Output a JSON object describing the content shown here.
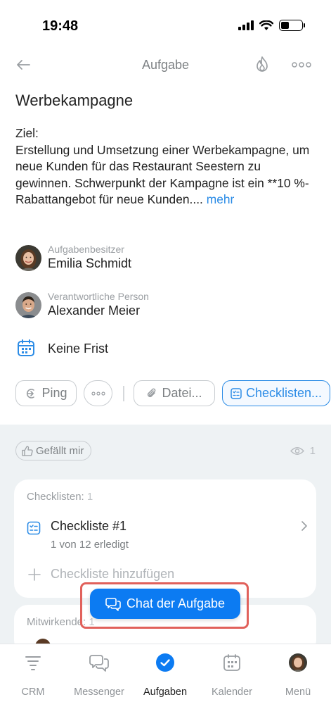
{
  "status_bar": {
    "time": "19:48"
  },
  "header": {
    "title": "Aufgabe",
    "icons": {
      "back": "arrow-left-icon",
      "flame": "flame-icon",
      "more": "more-horizontal-icon"
    }
  },
  "task": {
    "title": "Werbekampagne",
    "description": "Ziel:\nErstellung und Umsetzung einer Werbekampagne, um neue Kunden für das Restaurant Seestern zu gewinnen. Schwerpunkt der Kampagne ist ein **10 %-Rabattangebot für neue Kunden....",
    "more_link": "mehr"
  },
  "people": [
    {
      "role": "Aufgabenbesitzer",
      "name": "Emilia Schmidt",
      "avatar": "female-avatar"
    },
    {
      "role": "Verantwortliche Person",
      "name": "Alexander Meier",
      "avatar": "male-avatar"
    }
  ],
  "deadline": {
    "text": "Keine Frist",
    "icon": "calendar-icon"
  },
  "chips": {
    "ping": "Ping",
    "more": "more-horizontal-icon",
    "files": "Datei...",
    "checklists": "Checklisten..."
  },
  "social": {
    "like_label": "Gefällt mir",
    "views": "1"
  },
  "checklists_card": {
    "label": "Checklisten:",
    "count": "1",
    "item": {
      "name": "Checkliste #1",
      "progress": "1 von 12 erledigt"
    },
    "add_label": "Checkliste hinzufügen"
  },
  "participants_card": {
    "label": "Mitwirkende:",
    "count": "1"
  },
  "chat_button": {
    "label": "Chat der Aufgabe"
  },
  "tabbar": [
    {
      "label": "CRM",
      "icon": "crm-funnel-icon"
    },
    {
      "label": "Messenger",
      "icon": "chat-bubbles-icon"
    },
    {
      "label": "Aufgaben",
      "icon": "check-circle-icon"
    },
    {
      "label": "Kalender",
      "icon": "calendar-icon"
    },
    {
      "label": "Menü",
      "icon": "user-avatar-icon"
    }
  ],
  "colors": {
    "accent": "#0c7bf2",
    "link": "#2c8ce6",
    "highlight": "#e1615b",
    "background_lower": "#eef2f4"
  }
}
